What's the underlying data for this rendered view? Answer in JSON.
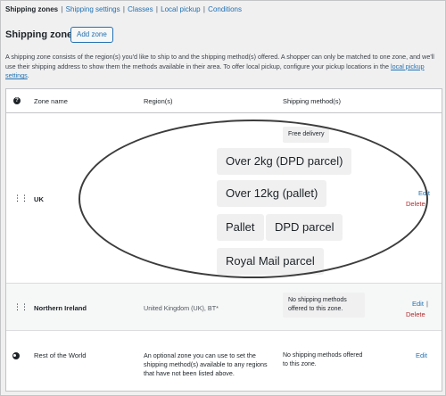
{
  "subnav": {
    "items": [
      {
        "label": "Shipping zones",
        "current": true
      },
      {
        "label": "Shipping settings",
        "current": false
      },
      {
        "label": "Classes",
        "current": false
      },
      {
        "label": "Local pickup",
        "current": false
      },
      {
        "label": "Conditions",
        "current": false
      }
    ],
    "separator": "|"
  },
  "page": {
    "title": "Shipping zones",
    "add_zone_label": "Add zone",
    "description_before_link": "A shipping zone consists of the region(s) you'd like to ship to and the shipping method(s) offered. A shopper can only be matched to one zone, and we'll use their shipping address to show them the methods available in their area. To offer local pickup, configure your pickup locations in the ",
    "description_link": "local pickup settings",
    "description_after_link": "."
  },
  "table": {
    "headers": {
      "help": "?",
      "zone_name": "Zone name",
      "regions": "Region(s)",
      "methods": "Shipping method(s)"
    },
    "rows": [
      {
        "zone_name": "UK",
        "region": "",
        "methods_small": "Free delivery",
        "methods": [
          "Over 2kg (DPD parcel)",
          "Over 12kg (pallet)",
          "Pallet",
          "DPD parcel",
          "Royal Mail parcel"
        ],
        "actions": {
          "edit": "Edit",
          "delete": "Delete"
        }
      },
      {
        "zone_name": "Northern Ireland",
        "region": "United Kingdom (UK), BT*",
        "methods_text": "No shipping methods offered to this zone.",
        "actions": {
          "edit": "Edit",
          "separator": "|",
          "delete": "Delete"
        }
      },
      {
        "zone_name": "Rest of the World",
        "region": "An optional zone you can use to set the shipping method(s) available to any regions that have not been listed above.",
        "methods_text": "No shipping methods offered to this zone.",
        "actions": {
          "edit": "Edit"
        }
      }
    ]
  },
  "colors": {
    "link": "#2271b1",
    "delete": "#b32d2e",
    "text": "#1d2327",
    "border": "#c3c4c7"
  }
}
